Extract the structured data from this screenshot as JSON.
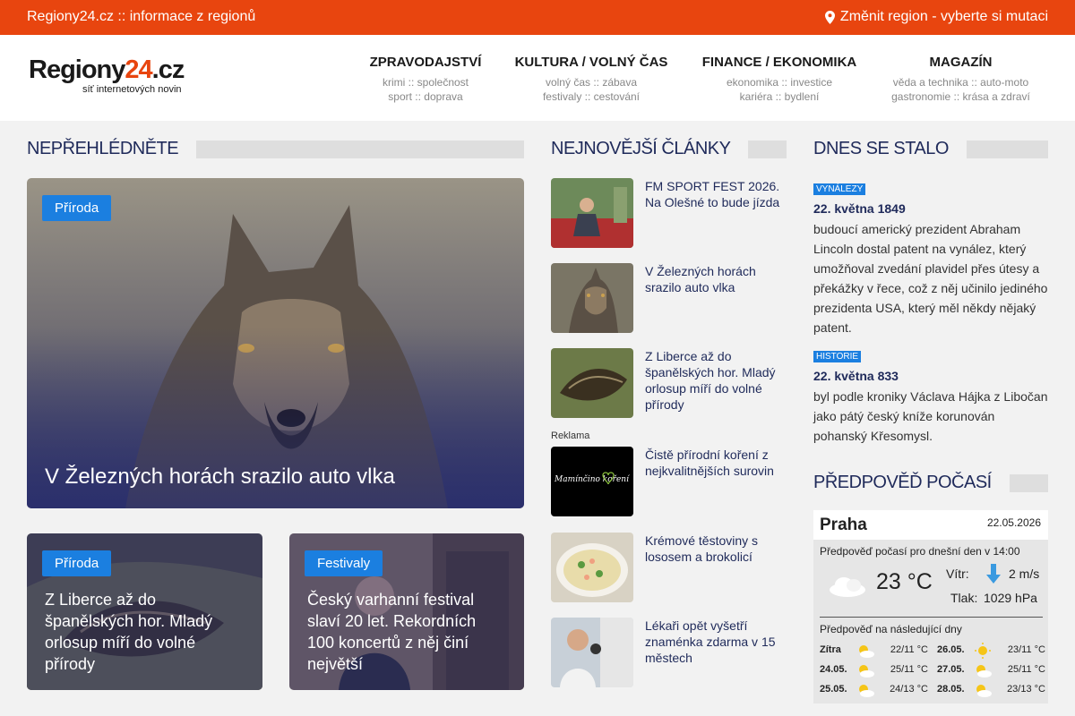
{
  "topbar": {
    "tagline": "Regiony24.cz :: informace z regionů",
    "region_link": "Změnit region - vyberte si mutaci"
  },
  "logo": {
    "main": "Regiony",
    "accent": "24",
    "tld": ".cz",
    "sub": "síť internetových novin"
  },
  "nav": [
    {
      "title": "ZPRAVODAJSTVÍ",
      "line1": "krimi :: společnost",
      "line2": "sport :: doprava"
    },
    {
      "title": "KULTURA / VOLNÝ ČAS",
      "line1": "volný čas :: zábava",
      "line2": "festivaly :: cestování"
    },
    {
      "title": "FINANCE / EKONOMIKA",
      "line1": "ekonomika :: investice",
      "line2": "kariéra :: bydlení"
    },
    {
      "title": "MAGAZÍN",
      "line1": "věda a technika :: auto-moto",
      "line2": "gastronomie :: krása a zdraví"
    }
  ],
  "sections": {
    "featured": "NEPŘEHLÉDNĚTE",
    "latest": "NEJNOVĚJŠÍ ČLÁNKY",
    "today": "DNES SE STALO",
    "weather": "PŘEDPOVĚĎ POČASÍ"
  },
  "hero": {
    "tag": "Příroda",
    "title": "V Železných horách srazilo auto vlka"
  },
  "cards": [
    {
      "tag": "Příroda",
      "title": "Z Liberce až do španělských hor. Mladý orlosup míří do volné přírody"
    },
    {
      "tag": "Festivaly",
      "title": "Český varhanní festival slaví 20 let. Rekordních 100 koncertů z něj činí největší"
    }
  ],
  "latest": [
    {
      "title": "FM SPORT FEST 2026. Na Olešné to bude jízda"
    },
    {
      "title": "V Železných horách srazilo auto vlka"
    },
    {
      "title": "Z Liberce až do španělských hor. Mladý orlosup míří do volné přírody"
    },
    {
      "title": "Čistě přírodní koření z nejkvalitnějších surovin",
      "ad_label": "Reklama",
      "ad_brand": "Mamínčino koření"
    },
    {
      "title": "Krémové těstoviny s lososem a brokolicí"
    },
    {
      "title": "Lékaři opět vyšetří znaménka zdarma v 15 městech"
    }
  ],
  "today": [
    {
      "badge": "VYNÁLEZY",
      "date": "22. května 1849",
      "text": "budoucí americký prezident Abraham Lincoln dostal patent na vynález, který umožňoval zvedání plavidel přes útesy a překážky v řece, což z něj učinilo jediného prezidenta USA, který měl někdy nějaký patent."
    },
    {
      "badge": "HISTORIE",
      "date": "22. května 833",
      "text": "byl podle kroniky Václava Hájka z Libočan jako pátý český kníže korunován pohanský Křesomysl."
    }
  ],
  "weather": {
    "city": "Praha",
    "date": "22.05.2026",
    "now_label": "Předpověď počasí pro dnešní den v 14:00",
    "temp": "23 °C",
    "wind_label": "Vítr:",
    "wind_value": "2 m/s",
    "pressure_label": "Tlak:",
    "pressure_value": "1029 hPa",
    "next_label": "Předpověď na následující dny",
    "days": [
      {
        "day": "Zítra",
        "temps": "22/11 °C",
        "icon": "sun-cloud-icon"
      },
      {
        "day": "26.05.",
        "temps": "23/11 °C",
        "icon": "sun-icon"
      },
      {
        "day": "24.05.",
        "temps": "25/11 °C",
        "icon": "sun-cloud-icon"
      },
      {
        "day": "27.05.",
        "temps": "25/11 °C",
        "icon": "sun-cloud-icon"
      },
      {
        "day": "25.05.",
        "temps": "24/13 °C",
        "icon": "sun-cloud-icon"
      },
      {
        "day": "28.05.",
        "temps": "23/13 °C",
        "icon": "sun-cloud-icon"
      }
    ]
  },
  "colors": {
    "brand": "#e8450f",
    "navy": "#1f2a5a",
    "tag_blue": "#1b7fe0"
  }
}
